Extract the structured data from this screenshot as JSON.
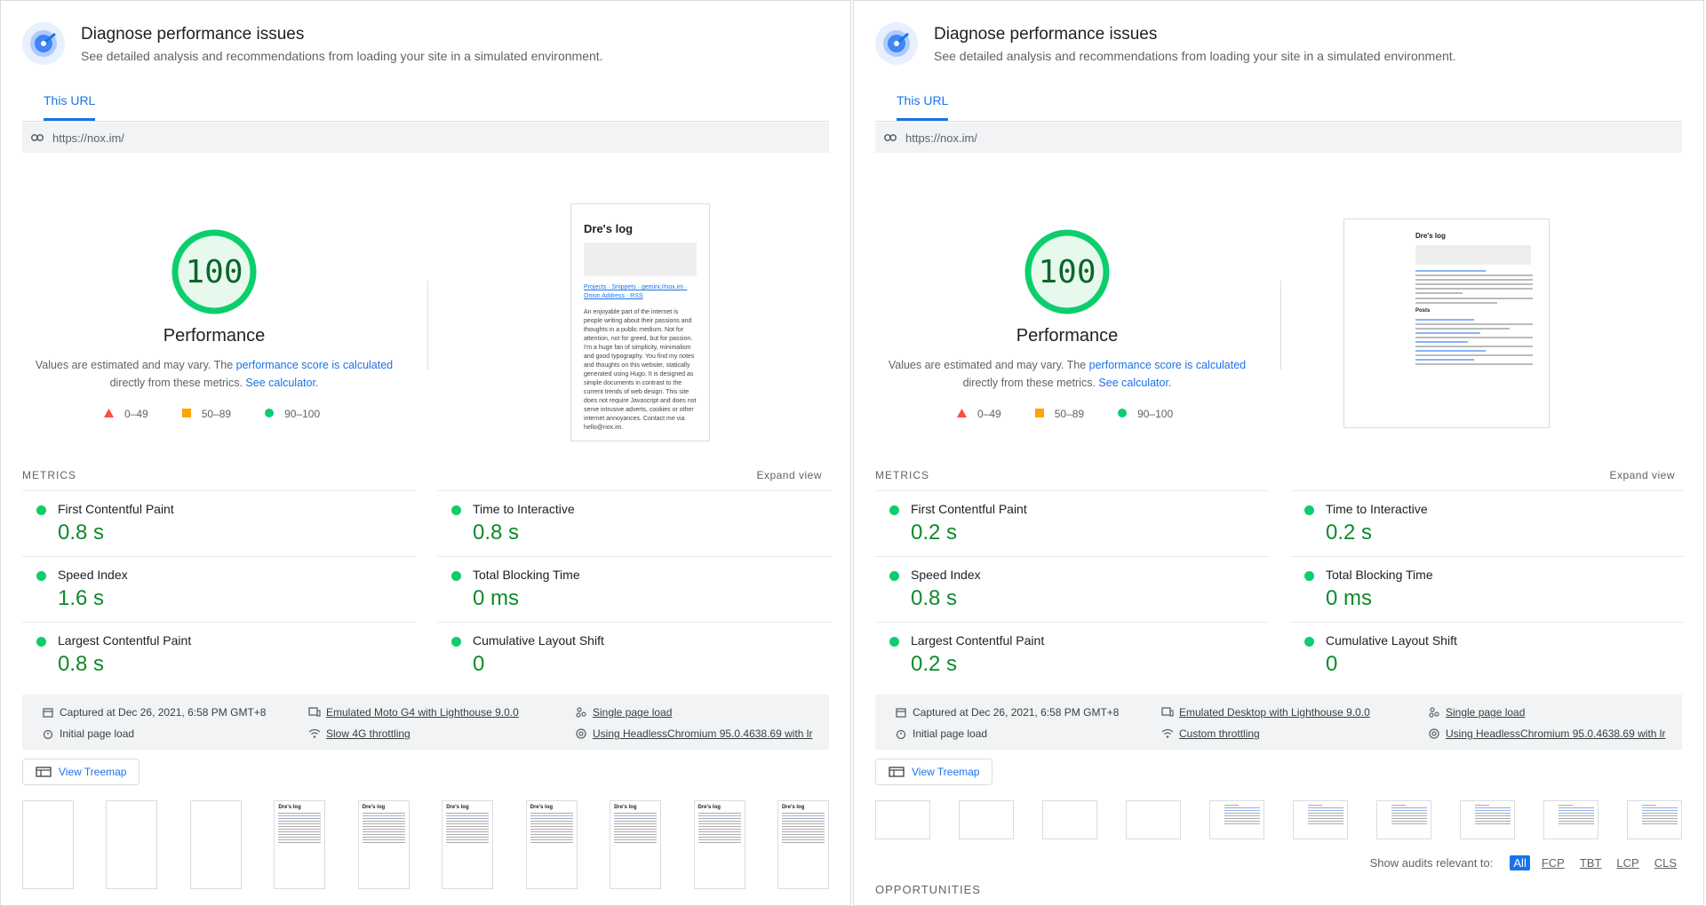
{
  "colors": {
    "accent": "#1a73e8",
    "pass": "#0cce6b",
    "average": "#ffa400",
    "fail": "#ff4e42"
  },
  "left": {
    "title": "Diagnose performance issues",
    "subtitle": "See detailed analysis and recommendations from loading your site in a simulated environment.",
    "tab": "This URL",
    "url": "https://nox.im/",
    "score": "100",
    "score_label": "Performance",
    "note_pre": "Values are estimated and may vary. The ",
    "note_link1": "performance score is calculated",
    "note_mid": "directly from these metrics. ",
    "note_link2": "See calculator.",
    "legend": [
      "0–49",
      "50–89",
      "90–100"
    ],
    "screenshot": {
      "title": "Dre's log",
      "links": "Projects · Snippets · gemini://nox.im · Onion Address · RSS",
      "body": "An enjoyable part of the internet is people writing about their passions and thoughts in a public medium. Not for attention, not for greed, but for passion. I'm a huge fan of simplicity, minimalism and good typography. You find my notes and thoughts on this website, statically generated using Hugo. It is designed as simple documents in contrast to the current trends of web design. This site does not require Javascript and does not serve intrusive adverts, cookies or other internet annoyances. Contact me via hello@nox.im."
    },
    "metrics_heading": "METRICS",
    "expand": "Expand view",
    "metrics": [
      {
        "name": "First Contentful Paint",
        "value": "0.8 s"
      },
      {
        "name": "Time to Interactive",
        "value": "0.8 s"
      },
      {
        "name": "Speed Index",
        "value": "1.6 s"
      },
      {
        "name": "Total Blocking Time",
        "value": "0 ms"
      },
      {
        "name": "Largest Contentful Paint",
        "value": "0.8 s"
      },
      {
        "name": "Cumulative Layout Shift",
        "value": "0"
      }
    ],
    "info": {
      "captured": "Captured at Dec 26, 2021, 6:58 PM GMT+8",
      "initial": "Initial page load",
      "device": "Emulated Moto G4 with Lighthouse 9.0.0",
      "throttle": "Slow 4G throttling",
      "single": "Single page load",
      "browser": "Using HeadlessChromium 95.0.4638.69 with lr"
    },
    "treemap": "View Treemap",
    "frame_title": "Dre's log"
  },
  "right": {
    "title": "Diagnose performance issues",
    "subtitle": "See detailed analysis and recommendations from loading your site in a simulated environment.",
    "tab": "This URL",
    "url": "https://nox.im/",
    "score": "100",
    "score_label": "Performance",
    "note_pre": "Values are estimated and may vary. The ",
    "note_link1": "performance score is calculated",
    "note_mid": "directly from these metrics. ",
    "note_link2": "See calculator.",
    "legend": [
      "0–49",
      "50–89",
      "90–100"
    ],
    "screenshot": {
      "title": "Dre's log",
      "posts": "Posts"
    },
    "metrics_heading": "METRICS",
    "expand": "Expand view",
    "metrics": [
      {
        "name": "First Contentful Paint",
        "value": "0.2 s"
      },
      {
        "name": "Time to Interactive",
        "value": "0.2 s"
      },
      {
        "name": "Speed Index",
        "value": "0.8 s"
      },
      {
        "name": "Total Blocking Time",
        "value": "0 ms"
      },
      {
        "name": "Largest Contentful Paint",
        "value": "0.2 s"
      },
      {
        "name": "Cumulative Layout Shift",
        "value": "0"
      }
    ],
    "info": {
      "captured": "Captured at Dec 26, 2021, 6:58 PM GMT+8",
      "initial": "Initial page load",
      "device": "Emulated Desktop with Lighthouse 9.0.0",
      "throttle": "Custom throttling",
      "single": "Single page load",
      "browser": "Using HeadlessChromium 95.0.4638.69 with lr"
    },
    "treemap": "View Treemap",
    "show_label": "Show audits relevant to:",
    "filters": [
      "All",
      "FCP",
      "TBT",
      "LCP",
      "CLS"
    ],
    "opportunities": "OPPORTUNITIES"
  }
}
